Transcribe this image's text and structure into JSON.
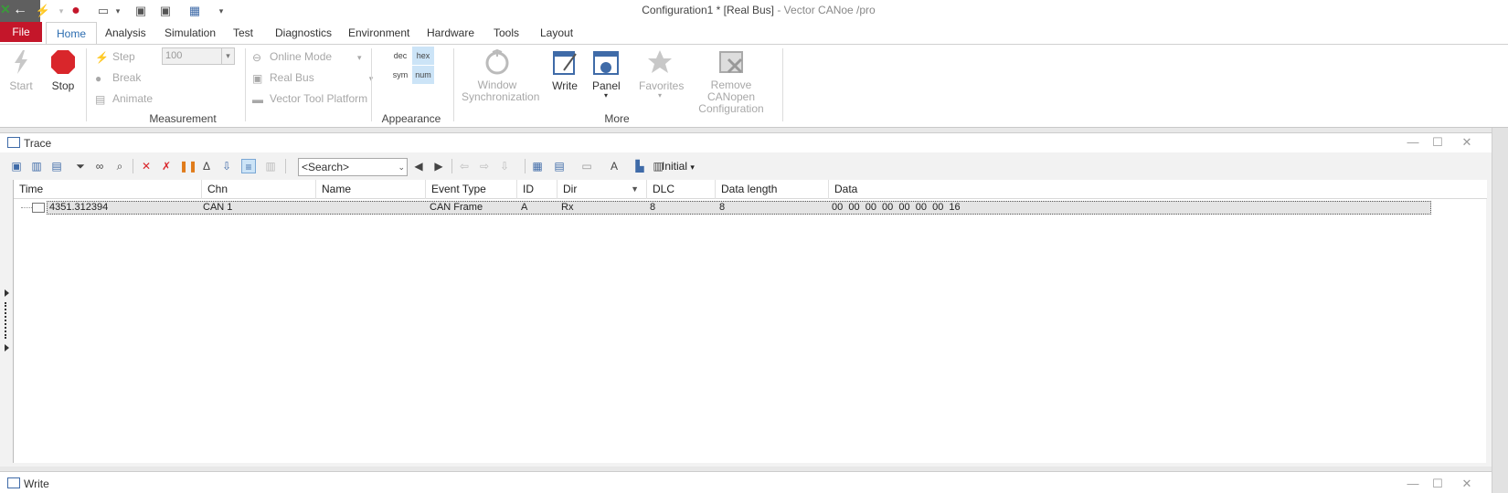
{
  "window_title": {
    "doc": "Configuration1 * [Real Bus]",
    "separator": " - ",
    "app": "Vector CANoe /pro"
  },
  "menu": {
    "file": "File",
    "tabs": [
      "Home",
      "Analysis",
      "Simulation",
      "Test",
      "Diagnostics",
      "Environment",
      "Hardware",
      "Tools",
      "Layout"
    ]
  },
  "ribbon": {
    "start": "Start",
    "stop": "Stop",
    "step": "Step",
    "break": "Break",
    "animate": "Animate",
    "combo_value": "100",
    "online_mode": "Online Mode",
    "real_bus": "Real Bus",
    "vector_tool_platform": "Vector Tool Platform",
    "group_measurement": "Measurement",
    "fmt_dec": "dec",
    "fmt_hex": "hex",
    "fmt_sym": "sym",
    "fmt_num": "num",
    "group_appearance": "Appearance",
    "window_sync_1": "Window",
    "window_sync_2": "Synchronization",
    "write": "Write",
    "panel": "Panel",
    "favorites": "Favorites",
    "remove_canopen_1": "Remove CANopen",
    "remove_canopen_2": "Configuration",
    "group_more": "More"
  },
  "trace": {
    "title": "Trace",
    "search_placeholder": "<Search>",
    "filter_label": "Initial",
    "columns": [
      "Time",
      "Chn",
      "Name",
      "Event Type",
      "ID",
      "Dir",
      "DLC",
      "Data length",
      "Data"
    ],
    "rows": [
      {
        "time": "4351.312394",
        "chn": "CAN 1",
        "name": "",
        "event_type": "CAN Frame",
        "id": "A",
        "dir": "Rx",
        "dlc": "8",
        "data_length": "8",
        "data": "00  00  00  00  00  00  00  16"
      }
    ]
  },
  "write_window": {
    "title": "Write"
  },
  "colors": {
    "file_tab": "#c4162a",
    "active_tab_text": "#2b6cb0",
    "stop_red": "#d9262b",
    "hex_highlight": "#cce4f7"
  }
}
